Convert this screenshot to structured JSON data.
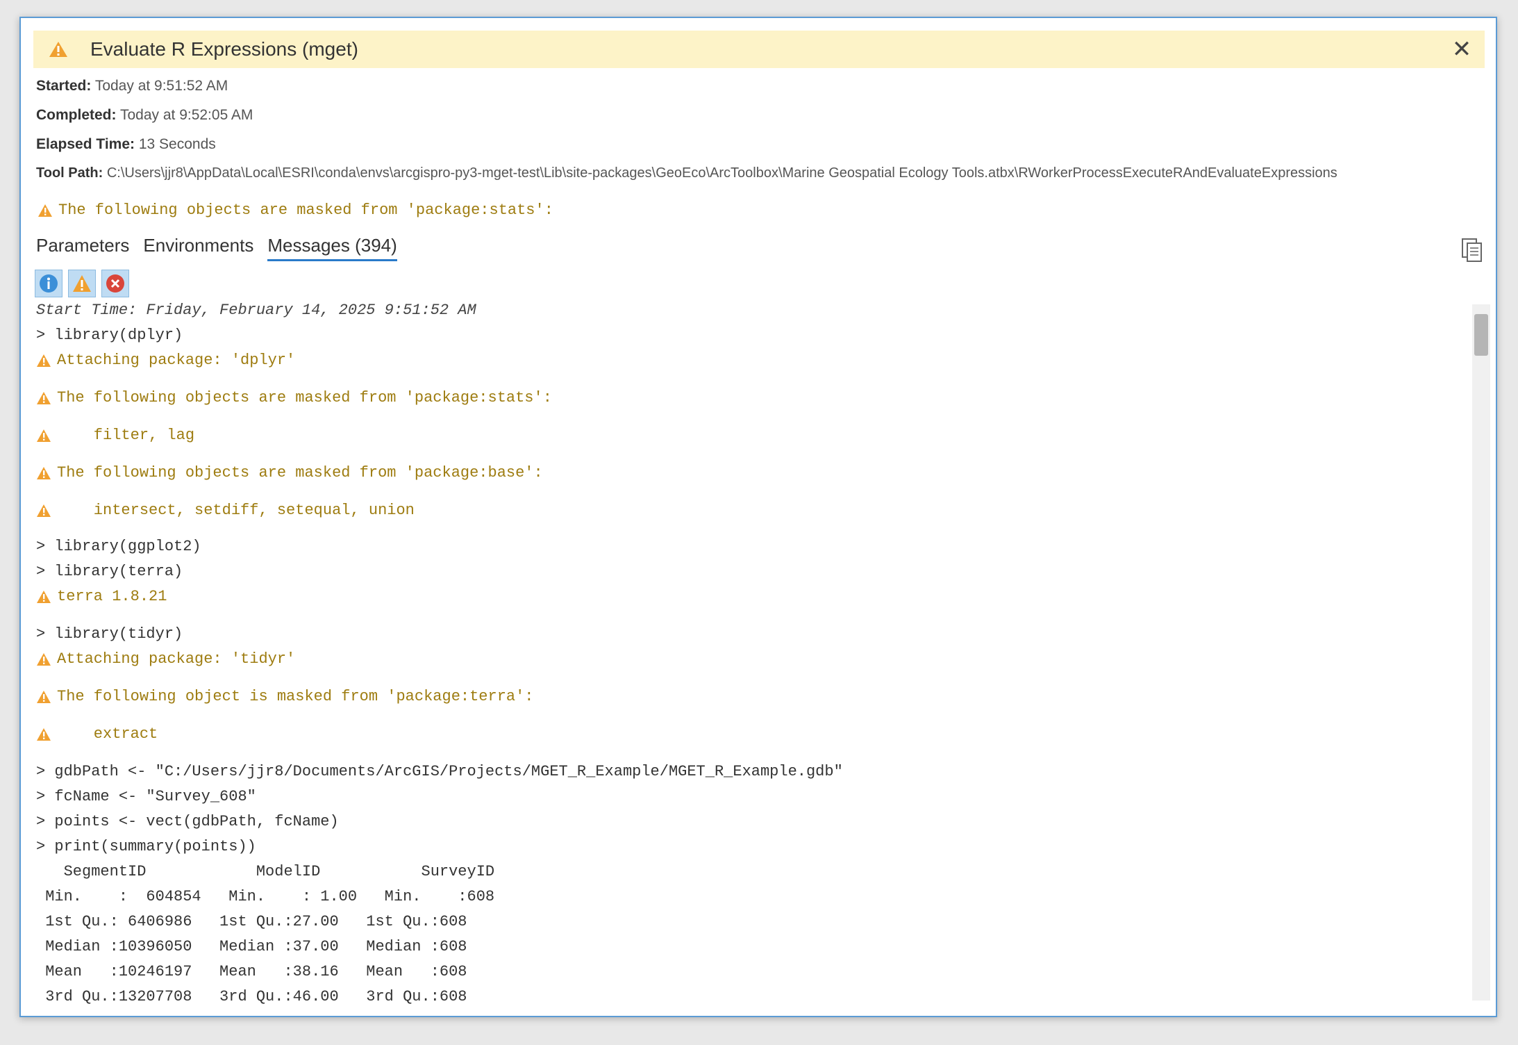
{
  "dialog": {
    "title": "Evaluate R Expressions (mget)",
    "close_glyph": "✕"
  },
  "meta": {
    "started_label": "Started:",
    "started_value": "Today at 9:51:52 AM",
    "completed_label": "Completed:",
    "completed_value": "Today at 9:52:05 AM",
    "elapsed_label": "Elapsed Time:",
    "elapsed_value": "13 Seconds",
    "toolpath_label": "Tool Path:",
    "toolpath_value": "C:\\Users\\jjr8\\AppData\\Local\\ESRI\\conda\\envs\\arcgispro-py3-mget-test\\Lib\\site-packages\\GeoEco\\ArcToolbox\\Marine Geospatial Ecology Tools.atbx\\RWorkerProcessExecuteRAndEvaluateExpressions"
  },
  "top_warning": "The following objects are masked from 'package:stats':",
  "tabs": [
    {
      "label": "Parameters"
    },
    {
      "label": "Environments"
    },
    {
      "label": "Messages (394)"
    }
  ],
  "filters": [
    "info-icon",
    "warning-icon",
    "error-icon"
  ],
  "colors": {
    "title_bg": "#fdf3c8",
    "warning_text": "#9e7c10",
    "warning_icon": "#f0a030",
    "tab_underline": "#2a7ac9",
    "border": "#5b9bd5"
  },
  "messages": [
    {
      "type": "italic",
      "text": "Start Time: Friday, February 14, 2025 9:51:52 AM"
    },
    {
      "type": "plain",
      "text": "> library(dplyr)"
    },
    {
      "type": "warn",
      "text": "Attaching package: 'dplyr'"
    },
    {
      "type": "warn",
      "text": "The following objects are masked from 'package:stats':"
    },
    {
      "type": "warn",
      "text": "    filter, lag"
    },
    {
      "type": "warn",
      "text": "The following objects are masked from 'package:base':"
    },
    {
      "type": "warn",
      "text": "    intersect, setdiff, setequal, union"
    },
    {
      "type": "plain",
      "text": "> library(ggplot2)"
    },
    {
      "type": "plain",
      "text": "> library(terra)"
    },
    {
      "type": "warn",
      "text": "terra 1.8.21"
    },
    {
      "type": "plain",
      "text": "> library(tidyr)"
    },
    {
      "type": "warn",
      "text": "Attaching package: 'tidyr'"
    },
    {
      "type": "warn",
      "text": "The following object is masked from 'package:terra':"
    },
    {
      "type": "warn",
      "text": "    extract"
    },
    {
      "type": "plain",
      "text": "> gdbPath <- \"C:/Users/jjr8/Documents/ArcGIS/Projects/MGET_R_Example/MGET_R_Example.gdb\""
    },
    {
      "type": "plain",
      "text": "> fcName <- \"Survey_608\""
    },
    {
      "type": "plain",
      "text": "> points <- vect(gdbPath, fcName)"
    },
    {
      "type": "plain",
      "text": "> print(summary(points))"
    },
    {
      "type": "plain",
      "text": "   SegmentID            ModelID           SurveyID"
    },
    {
      "type": "plain",
      "text": " Min.    :  604854   Min.    : 1.00   Min.    :608"
    },
    {
      "type": "plain",
      "text": " 1st Qu.: 6406986   1st Qu.:27.00   1st Qu.:608"
    },
    {
      "type": "plain",
      "text": " Median :10396050   Median :37.00   Median :608"
    },
    {
      "type": "plain",
      "text": " Mean   :10246197   Mean   :38.16   Mean   :608"
    },
    {
      "type": "plain",
      "text": " 3rd Qu.:13207708   3rd Qu.:46.00   3rd Qu.:608"
    }
  ]
}
